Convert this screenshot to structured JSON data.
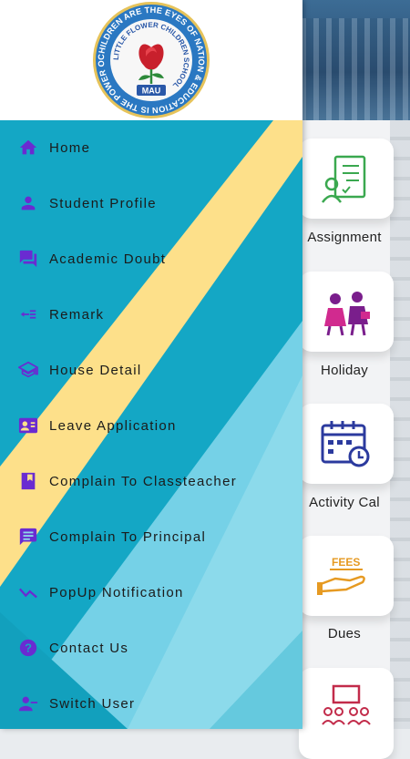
{
  "logo": {
    "ring_text": "CHILDREN ARE THE EYES OF NATION & EDUCATION IS THE POWER OF EYES",
    "inner_text": "LITTLE FLOWER CHILDREN SCHOOL",
    "badge": "MAU"
  },
  "colors": {
    "drawer_blue": "#14a7c5",
    "drawer_light": "#7fd6ea",
    "drawer_yellow": "#fde08a",
    "icon_purple": "#6a2bd1"
  },
  "menu": [
    {
      "label": "Home",
      "icon": "home-icon"
    },
    {
      "label": "Student Profile",
      "icon": "person-icon"
    },
    {
      "label": "Academic Doubt",
      "icon": "chat-bubbles-icon"
    },
    {
      "label": "Remark",
      "icon": "indent-list-icon"
    },
    {
      "label": "House Detail",
      "icon": "graduation-cap-icon"
    },
    {
      "label": "Leave Application",
      "icon": "contact-card-icon"
    },
    {
      "label": "Complain To Classteacher",
      "icon": "flag-book-icon"
    },
    {
      "label": "Complain To Principal",
      "icon": "message-lines-icon"
    },
    {
      "label": "PopUp Notification",
      "icon": "checkmark-trend-icon"
    },
    {
      "label": "Contact Us",
      "icon": "help-icon"
    },
    {
      "label": "Switch User",
      "icon": "person-remove-icon"
    }
  ],
  "tiles": [
    {
      "label": "Assignment",
      "icon": "assignment-icon"
    },
    {
      "label": "Holiday",
      "icon": "holiday-icon"
    },
    {
      "label": "Activity Cal",
      "icon": "calendar-clock-icon"
    },
    {
      "label": "Dues",
      "icon": "fees-hand-icon",
      "icon_text": "FEES"
    },
    {
      "label": "",
      "icon": "classroom-icon"
    }
  ]
}
